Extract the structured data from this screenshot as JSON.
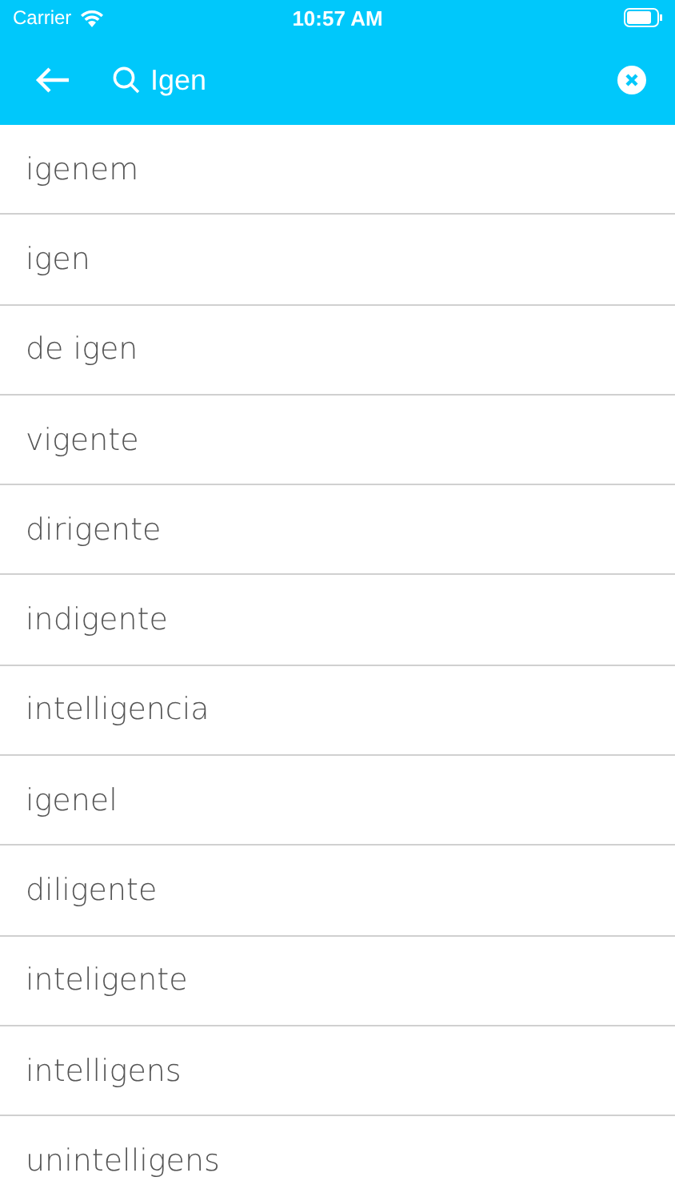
{
  "status_bar": {
    "carrier": "Carrier",
    "time": "10:57 AM"
  },
  "search": {
    "value": "Igen"
  },
  "results": [
    "igenem",
    "igen",
    "de igen",
    "vigente",
    "dirigente",
    "indigente",
    "intelligencia",
    "igenel",
    "diligente",
    "inteligente",
    "intelligens",
    "unintelligens"
  ]
}
